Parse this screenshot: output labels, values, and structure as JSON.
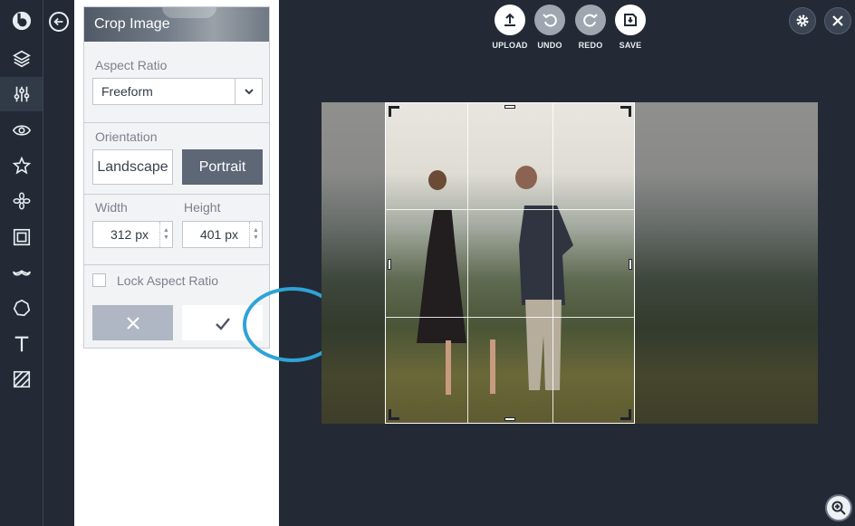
{
  "sidebar": {
    "icons": [
      "logo-icon",
      "layers-icon",
      "adjust-sliders-icon",
      "eye-icon",
      "star-icon",
      "flower-icon",
      "frame-icon",
      "mustache-icon",
      "shape-icon",
      "text-icon",
      "texture-icon"
    ]
  },
  "panel": {
    "title": "Crop Image",
    "aspect_ratio_label": "Aspect Ratio",
    "aspect_ratio_value": "Freeform",
    "orientation_label": "Orientation",
    "landscape_label": "Landscape",
    "portrait_label": "Portrait",
    "width_label": "Width",
    "height_label": "Height",
    "width_value": "312 px",
    "height_value": "401 px",
    "lock_label": "Lock Aspect Ratio"
  },
  "toolbar": {
    "upload_label": "UPLOAD",
    "undo_label": "UNDO",
    "redo_label": "REDO",
    "save_label": "SAVE"
  },
  "colors": {
    "background": "#232a35",
    "accent_ring": "#2fa3d6",
    "portrait_active": "#5d6776",
    "cancel_button": "#aeb7c3"
  }
}
